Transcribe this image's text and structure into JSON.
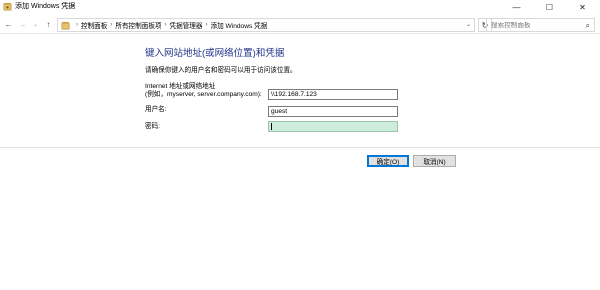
{
  "window": {
    "title": "添加 Windows 凭据",
    "minimize_glyph": "—",
    "maximize_glyph": "☐",
    "close_glyph": "✕"
  },
  "navigation": {
    "back_glyph": "←",
    "forward_glyph": "→",
    "dropdown_glyph": "⌄",
    "up_glyph": "↑",
    "breadcrumbs": [
      "控制面板",
      "所有控制面板项",
      "凭据管理器",
      "添加 Windows 凭据"
    ],
    "refresh_glyph": "↻",
    "search_placeholder": "搜索控制面板",
    "search_glyph": "⌕"
  },
  "form": {
    "heading": "键入网站地址(或网络位置)和凭据",
    "instruction": "请确保你键入的用户名和密码可以用于访问该位置。",
    "address_label_line1": "Internet 地址或网络地址",
    "address_label_line2": "(例如，myserver, server.company.com):",
    "address_value": "\\\\192.168.7.123",
    "username_label": "用户名:",
    "username_value": "guest",
    "password_label": "密码:",
    "password_value": ""
  },
  "buttons": {
    "ok_label": "确定(O)",
    "cancel_label": "取消(N)"
  },
  "colors": {
    "heading": "#1e3287",
    "password_field_bg": "#cdeedd",
    "default_button_border": "#0078d7"
  },
  "icons": {
    "window_icon": "credential-manager-icon",
    "address_icon": "control-panel-icon",
    "search": "search-icon"
  }
}
